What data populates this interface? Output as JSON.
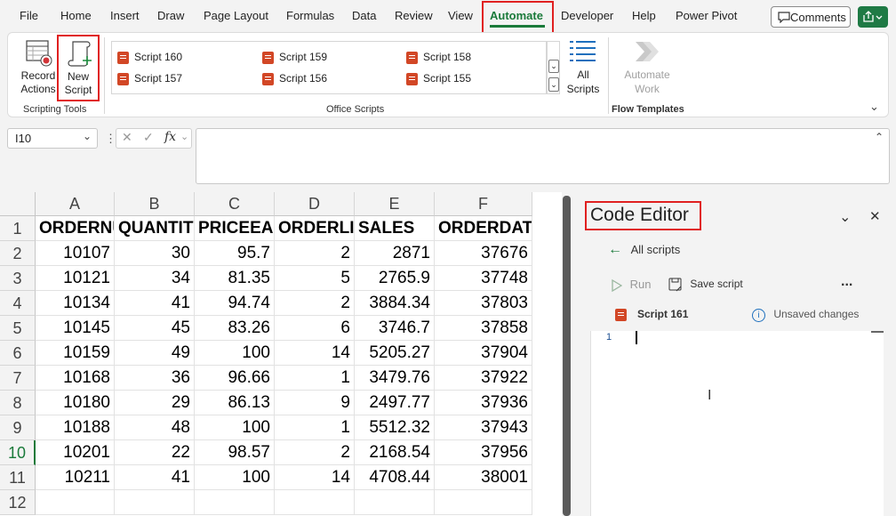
{
  "menu": {
    "items": [
      "File",
      "Home",
      "Insert",
      "Draw",
      "Page Layout",
      "Formulas",
      "Data",
      "Review",
      "View",
      "Automate",
      "Developer",
      "Help",
      "Power Pivot"
    ],
    "active": "Automate",
    "comments_label": "Comments"
  },
  "ribbon": {
    "record_label": "Record Actions",
    "new_script_label": "New Script",
    "scripting_tools_label": "Scripting Tools",
    "scripts": [
      "Script 160",
      "Script 159",
      "Script 158",
      "Script 157",
      "Script 156",
      "Script 155"
    ],
    "all_scripts_label": "All Scripts",
    "office_scripts_label": "Office Scripts",
    "automate_work_label": "Automate Work",
    "flow_templates_label": "Flow Templates"
  },
  "formula_bar": {
    "name_box": "I10",
    "fx_label": "fx",
    "value": ""
  },
  "sheet": {
    "columns": [
      "A",
      "B",
      "C",
      "D",
      "E",
      "F"
    ],
    "rows": [
      "1",
      "2",
      "3",
      "4",
      "5",
      "6",
      "7",
      "8",
      "9",
      "10",
      "11",
      "12"
    ],
    "selected_row": "10",
    "header": [
      "ORDERNU",
      "QUANTITY",
      "PRICEEAC",
      "ORDERLIN",
      "SALES",
      "ORDERDATE"
    ],
    "data": [
      [
        "10107",
        "30",
        "95.7",
        "2",
        "2871",
        "37676"
      ],
      [
        "10121",
        "34",
        "81.35",
        "5",
        "2765.9",
        "37748"
      ],
      [
        "10134",
        "41",
        "94.74",
        "2",
        "3884.34",
        "37803"
      ],
      [
        "10145",
        "45",
        "83.26",
        "6",
        "3746.7",
        "37858"
      ],
      [
        "10159",
        "49",
        "100",
        "14",
        "5205.27",
        "37904"
      ],
      [
        "10168",
        "36",
        "96.66",
        "1",
        "3479.76",
        "37922"
      ],
      [
        "10180",
        "29",
        "86.13",
        "9",
        "2497.77",
        "37936"
      ],
      [
        "10188",
        "48",
        "100",
        "1",
        "5512.32",
        "37943"
      ],
      [
        "10201",
        "22",
        "98.57",
        "2",
        "2168.54",
        "37956"
      ],
      [
        "10211",
        "41",
        "100",
        "14",
        "4708.44",
        "38001"
      ]
    ]
  },
  "code_editor": {
    "title": "Code Editor",
    "back_label": "All scripts",
    "run_label": "Run",
    "save_label": "Save script",
    "more_label": "...",
    "script_name": "Script 161",
    "status": "Unsaved changes",
    "line_number": "1"
  },
  "colors": {
    "accent_green": "#1a7a3a",
    "highlight_red": "#e02020",
    "script_icon": "#d24726"
  }
}
